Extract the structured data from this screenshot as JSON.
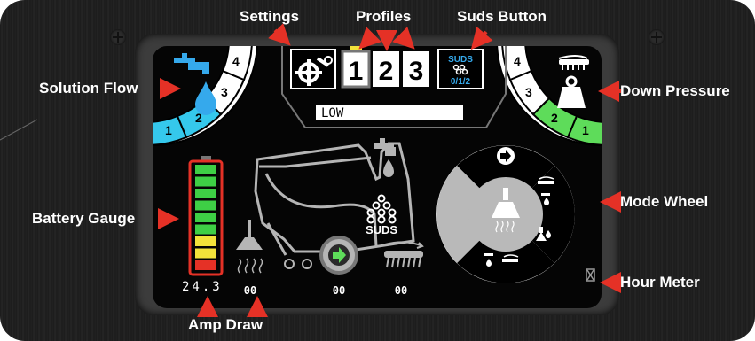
{
  "callouts": {
    "settings": "Settings",
    "profiles": "Profiles",
    "suds_button": "Suds Button",
    "solution_flow": "Solution Flow",
    "down_pressure": "Down Pressure",
    "battery_gauge": "Battery Gauge",
    "mode_wheel": "Mode Wheel",
    "hour_meter": "Hour Meter",
    "amp_draw": "Amp Draw"
  },
  "solution_flow_arc": {
    "levels": [
      "1",
      "2",
      "3",
      "4"
    ],
    "active_level": 2
  },
  "down_pressure_arc": {
    "levels": [
      "1",
      "2",
      "3",
      "4"
    ],
    "active_level": 2
  },
  "profiles": {
    "buttons": [
      "1",
      "2",
      "3"
    ],
    "selected": "1"
  },
  "suds_button": {
    "label": "SUDS",
    "sub": "0/1/2"
  },
  "profile_name": "LOW",
  "battery": {
    "segments_total": 9,
    "green": 6,
    "yellow": 2,
    "red": 1
  },
  "readouts": {
    "amp": "24.3",
    "brush": "00",
    "drive": "00",
    "scrub": "00"
  },
  "suds_tank_label": "SUDS",
  "colors": {
    "cyan": "#35c8ec",
    "green": "#5edc5a",
    "red": "#e53126",
    "yellow": "#f2e33a",
    "battery_green": "#3ecf45"
  }
}
